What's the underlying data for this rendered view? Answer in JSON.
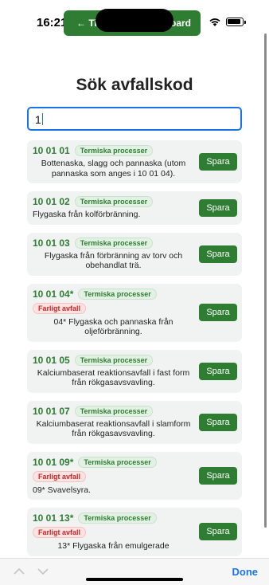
{
  "status_bar": {
    "time": "16:21",
    "back_left": "← Ti",
    "back_right": "bard"
  },
  "page": {
    "title": "Sök avfallskod",
    "search_value": "1"
  },
  "save_label": "Spara",
  "items": [
    {
      "code": "10 01 01",
      "category": "Termiska processer",
      "hazard": "",
      "description": "Bottenaska, slagg och pannaska (utom pannaska som anges i 10 01 04).",
      "center": true
    },
    {
      "code": "10 01 02",
      "category": "Termiska processer",
      "hazard": "",
      "description": "Flygaska från kolförbränning.",
      "center": false
    },
    {
      "code": "10 01 03",
      "category": "Termiska processer",
      "hazard": "",
      "description": "Flygaska från förbränning av torv och obehandlat trä.",
      "center": true
    },
    {
      "code": "10 01 04*",
      "category": "Termiska processer",
      "hazard": "Farligt avfall",
      "description": "04* Flygaska och pannaska från oljeförbränning.",
      "center": true
    },
    {
      "code": "10 01 05",
      "category": "Termiska processer",
      "hazard": "",
      "description": "Kalciumbaserat reaktionsavfall i fast form från rökgasavsvavling.",
      "center": true
    },
    {
      "code": "10 01 07",
      "category": "Termiska processer",
      "hazard": "",
      "description": "Kalciumbaserat reaktionsavfall i slamform från rökgasavsvavling.",
      "center": true
    },
    {
      "code": "10 01 09*",
      "category": "Termiska processer",
      "hazard": "Farligt avfall",
      "description": "09* Svavelsyra.",
      "center": false
    },
    {
      "code": "10 01 13*",
      "category": "Termiska processer",
      "hazard": "Farligt avfall",
      "description": "13* Flygaska från emulgerade",
      "center": true
    }
  ],
  "keyboard_bar": {
    "done_label": "Done"
  }
}
